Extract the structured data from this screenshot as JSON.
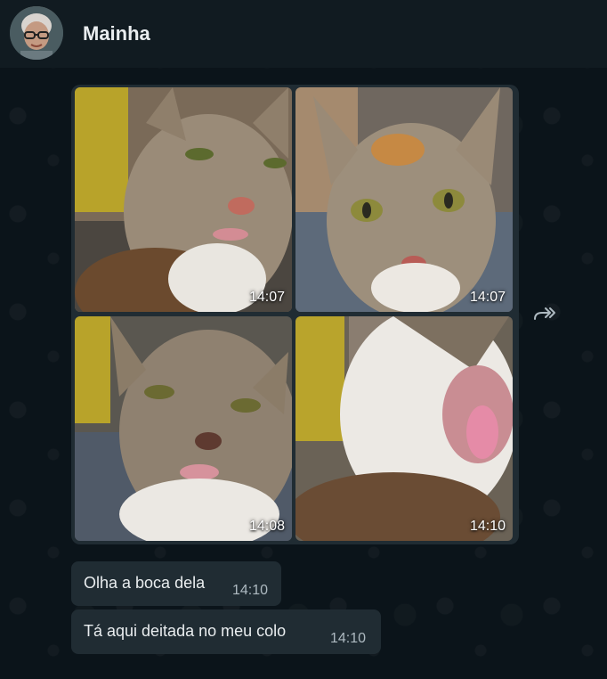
{
  "header": {
    "contact_name": "Mainha",
    "avatar_icon": "contact-avatar"
  },
  "media_group": {
    "photos": [
      {
        "subject": "cat",
        "time": "14:07"
      },
      {
        "subject": "cat",
        "time": "14:07"
      },
      {
        "subject": "cat",
        "time": "14:08"
      },
      {
        "subject": "cat",
        "time": "14:10"
      }
    ],
    "forward_icon": "forward-icon"
  },
  "messages": [
    {
      "text": "Olha a boca dela",
      "time": "14:10"
    },
    {
      "text": "Tá aqui deitada no meu colo",
      "time": "14:10"
    }
  ],
  "colors": {
    "background": "#0b141a",
    "header": "#111b21",
    "bubble": "#202c33",
    "text": "#e9edef",
    "meta_text": "#aebac1"
  }
}
